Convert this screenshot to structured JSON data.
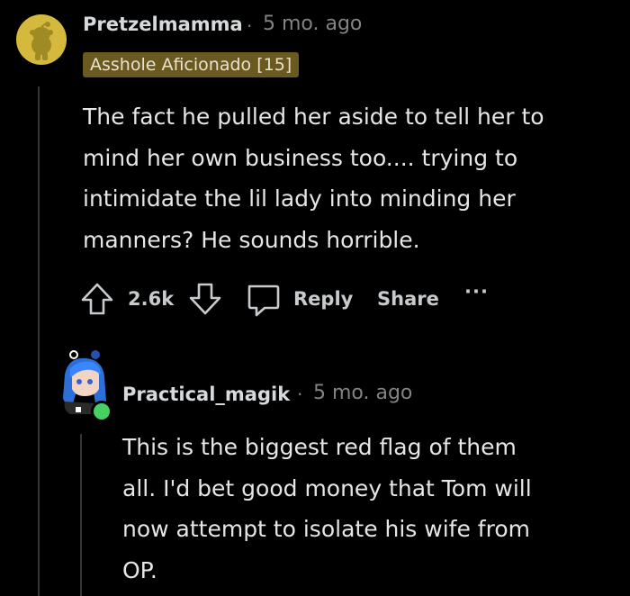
{
  "comment1": {
    "username": "Pretzelmamma",
    "separator": "·",
    "time": "5 mo. ago",
    "flair": "Asshole Aficionado [15]",
    "body_lines": [
      "The fact he pulled her aside to tell her to",
      "mind her own business too.... trying to",
      "intimidate the lil lady into minding her",
      "manners? He sounds horrible."
    ],
    "actions": {
      "score": "2.6k",
      "reply_label": "Reply",
      "share_label": "Share",
      "more_label": "···"
    },
    "avatar_icon": "snoo-avatar-icon"
  },
  "comment2": {
    "username": "Practical_magik",
    "separator": "·",
    "time": "5 mo. ago",
    "body_lines": [
      "This is the biggest red flag of them",
      "all. I'd bet good money that Tom will",
      "now attempt to isolate his wife from",
      "OP."
    ],
    "avatar_icon": "custom-avatar-icon",
    "online_indicator": "online-status-icon"
  },
  "colors": {
    "background": "#000000",
    "flair_bg": "#6b5a1f",
    "online_green": "#46d160",
    "avatar_yellow": "#d4b93c"
  }
}
